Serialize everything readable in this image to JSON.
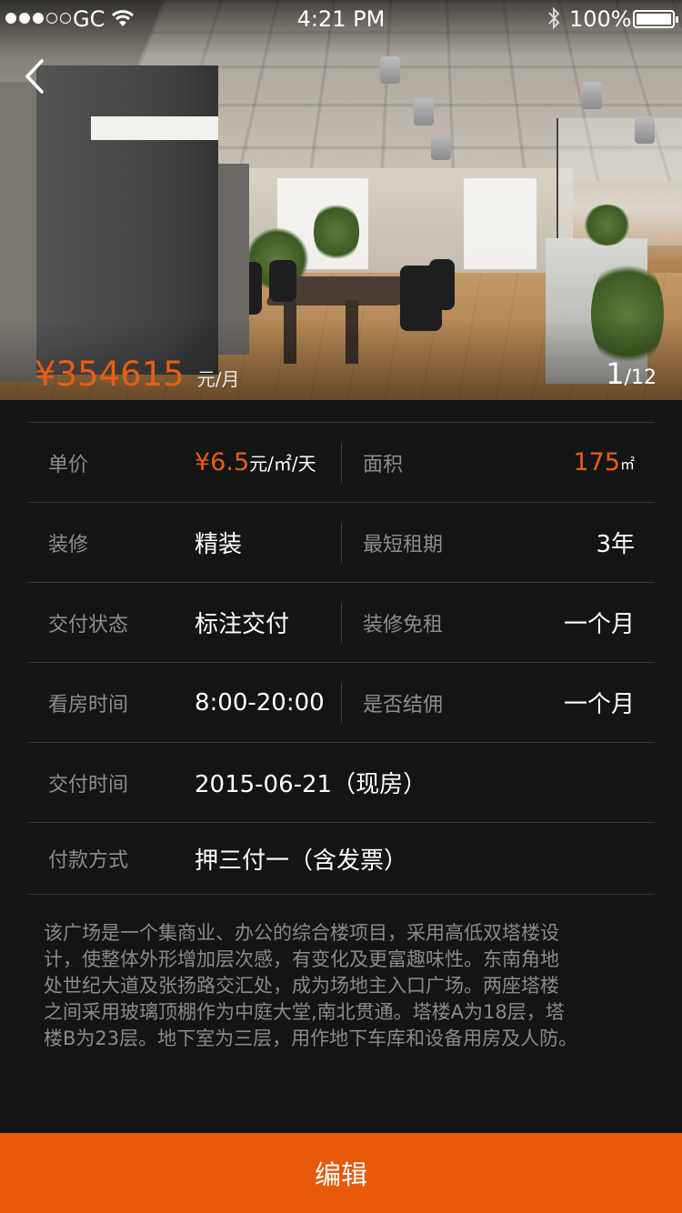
{
  "status_bar": {
    "carrier": "GC",
    "time": "4:21 PM",
    "battery": "100%"
  },
  "hero": {
    "price": "¥354615",
    "price_unit": "元/月",
    "pager_current": "1",
    "pager_total": "/12"
  },
  "specs": [
    {
      "left_label": "单价",
      "left_value": "¥6.5",
      "left_unit": "元/㎡/天",
      "right_label": "面积",
      "right_value": "175",
      "right_unit": "㎡"
    },
    {
      "left_label": "装修",
      "left_value": "精装",
      "right_label": "最短租期",
      "right_value": "3年"
    },
    {
      "left_label": "交付状态",
      "left_value": "标注交付",
      "right_label": "装修免租",
      "right_value": "一个月"
    },
    {
      "left_label": "看房时间",
      "left_value": "8:00-20:00",
      "right_label": "是否结佣",
      "right_value": "一个月"
    },
    {
      "label": "交付时间",
      "value": "2015-06-21（现房）"
    },
    {
      "label": "付款方式",
      "value": "押三付一（含发票）"
    }
  ],
  "description_lines": [
    "该广场是一个集商业、办公的综合楼项目，采用高低双塔楼设",
    "计，使整体外形增加层次感，有变化及更富趣味性。东南角地",
    "处世纪大道及张扬路交汇处，成为场地主入口广场。两座塔楼",
    "之间采用玻璃顶棚作为中庭大堂,南北贯通。塔楼A为18层，塔",
    "楼B为23层。地下室为三层，用作地下车库和设备用房及人防。"
  ],
  "edit_button": "编辑",
  "colors": {
    "accent": "#e85e14",
    "button": "#e8590c",
    "background": "#141414",
    "label": "#8d8d8d",
    "divider": "#333333"
  },
  "icons": [
    "back-chevron-icon",
    "wifi-icon",
    "bluetooth-icon",
    "battery-icon"
  ]
}
